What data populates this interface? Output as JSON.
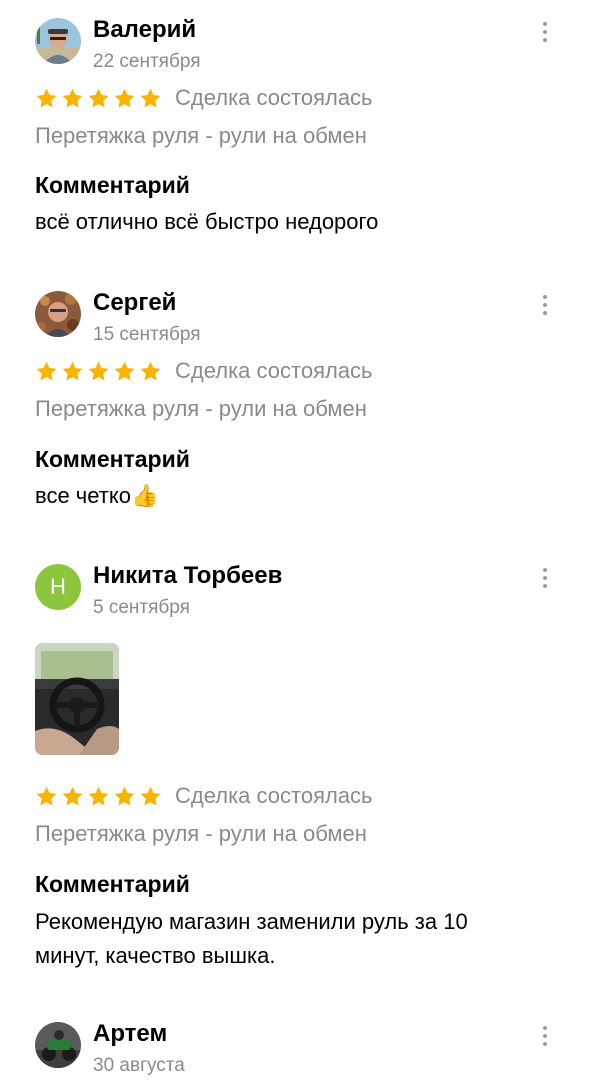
{
  "reviews": [
    {
      "author": "Валерий",
      "date": "22 сентября",
      "rating": 5,
      "deal_status": "Сделка состоялась",
      "item": "Перетяжка руля - рули на обмен",
      "comment_label": "Комментарий",
      "comment": "всё отлично всё быстро недорого"
    },
    {
      "author": "Сергей",
      "date": "15 сентября",
      "rating": 5,
      "deal_status": "Сделка состоялась",
      "item": "Перетяжка руля - рули на обмен",
      "comment_label": "Комментарий",
      "comment": "все четко👍"
    },
    {
      "author": "Никита Торбеев",
      "date": "5 сентября",
      "avatar_letter": "Н",
      "rating": 5,
      "deal_status": "Сделка состоялась",
      "item": "Перетяжка руля - рули на обмен",
      "comment_label": "Комментарий",
      "comment": "Рекомендую магазин заменили руль за 10 минут, качество вышка."
    },
    {
      "author": "Артем",
      "date": "30 августа"
    }
  ],
  "colors": {
    "star": "#f7b500",
    "muted_text": "#8a8a8a",
    "avatar_letter_bg": "#8cc63f"
  },
  "icons": {
    "star": "star-icon",
    "menu": "more-vertical-icon"
  }
}
